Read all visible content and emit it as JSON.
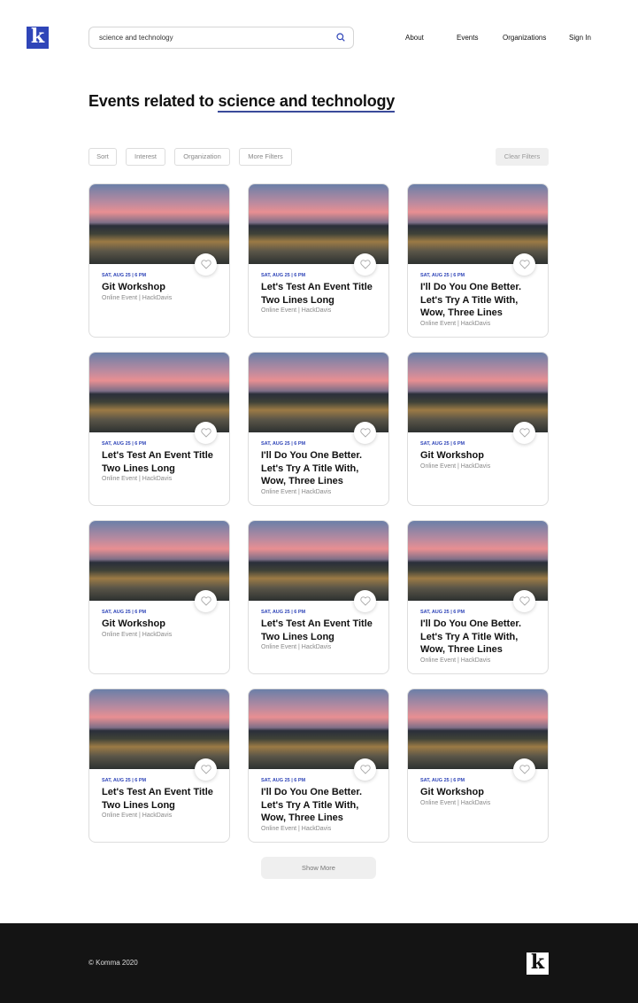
{
  "header": {
    "logo": "k",
    "search_value": "science and technology",
    "nav": [
      "About",
      "Events",
      "Organizations",
      "Sign In"
    ]
  },
  "heading": {
    "prefix": "Events related to ",
    "query": "science and technology"
  },
  "filters": [
    "Sort",
    "Interest",
    "Organization",
    "More Filters"
  ],
  "clear_filters": "Clear Filters",
  "cards": [
    {
      "date": "SAT, AUG 25 | 6 PM",
      "title": "Git Workshop",
      "meta": "Online Event | HackDavis"
    },
    {
      "date": "SAT, AUG 25 | 6 PM",
      "title": "Let's Test An Event Title Two Lines Long",
      "meta": "Online Event | HackDavis"
    },
    {
      "date": "SAT, AUG 25 | 6 PM",
      "title": "I'll Do You One Better. Let's Try A Title With, Wow, Three Lines",
      "meta": "Online Event | HackDavis"
    },
    {
      "date": "SAT, AUG 25 | 6 PM",
      "title": "Let's Test An Event Title Two Lines Long",
      "meta": "Online Event | HackDavis"
    },
    {
      "date": "SAT, AUG 25 | 6 PM",
      "title": "I'll Do You One Better. Let's Try A Title With, Wow, Three Lines",
      "meta": "Online Event | HackDavis"
    },
    {
      "date": "SAT, AUG 25 | 6 PM",
      "title": "Git Workshop",
      "meta": "Online Event | HackDavis"
    },
    {
      "date": "SAT, AUG 25 | 6 PM",
      "title": "Git Workshop",
      "meta": "Online Event | HackDavis"
    },
    {
      "date": "SAT, AUG 25 | 6 PM",
      "title": "Let's Test An Event Title Two Lines Long",
      "meta": "Online Event | HackDavis"
    },
    {
      "date": "SAT, AUG 25 | 6 PM",
      "title": "I'll Do You One Better. Let's Try A Title With, Wow, Three Lines",
      "meta": "Online Event | HackDavis"
    },
    {
      "date": "SAT, AUG 25 | 6 PM",
      "title": "Let's Test An Event Title Two Lines Long",
      "meta": "Online Event | HackDavis"
    },
    {
      "date": "SAT, AUG 25 | 6 PM",
      "title": "I'll Do You One Better. Let's Try A Title With, Wow, Three Lines",
      "meta": "Online Event | HackDavis"
    },
    {
      "date": "SAT, AUG 25 | 6 PM",
      "title": "Git Workshop",
      "meta": "Online Event | HackDavis"
    }
  ],
  "show_more": "Show More",
  "footer": {
    "copyright": "© Komma 2020",
    "logo": "k"
  },
  "colors": {
    "brand": "#2f45b8",
    "footer_bg": "#141414"
  }
}
